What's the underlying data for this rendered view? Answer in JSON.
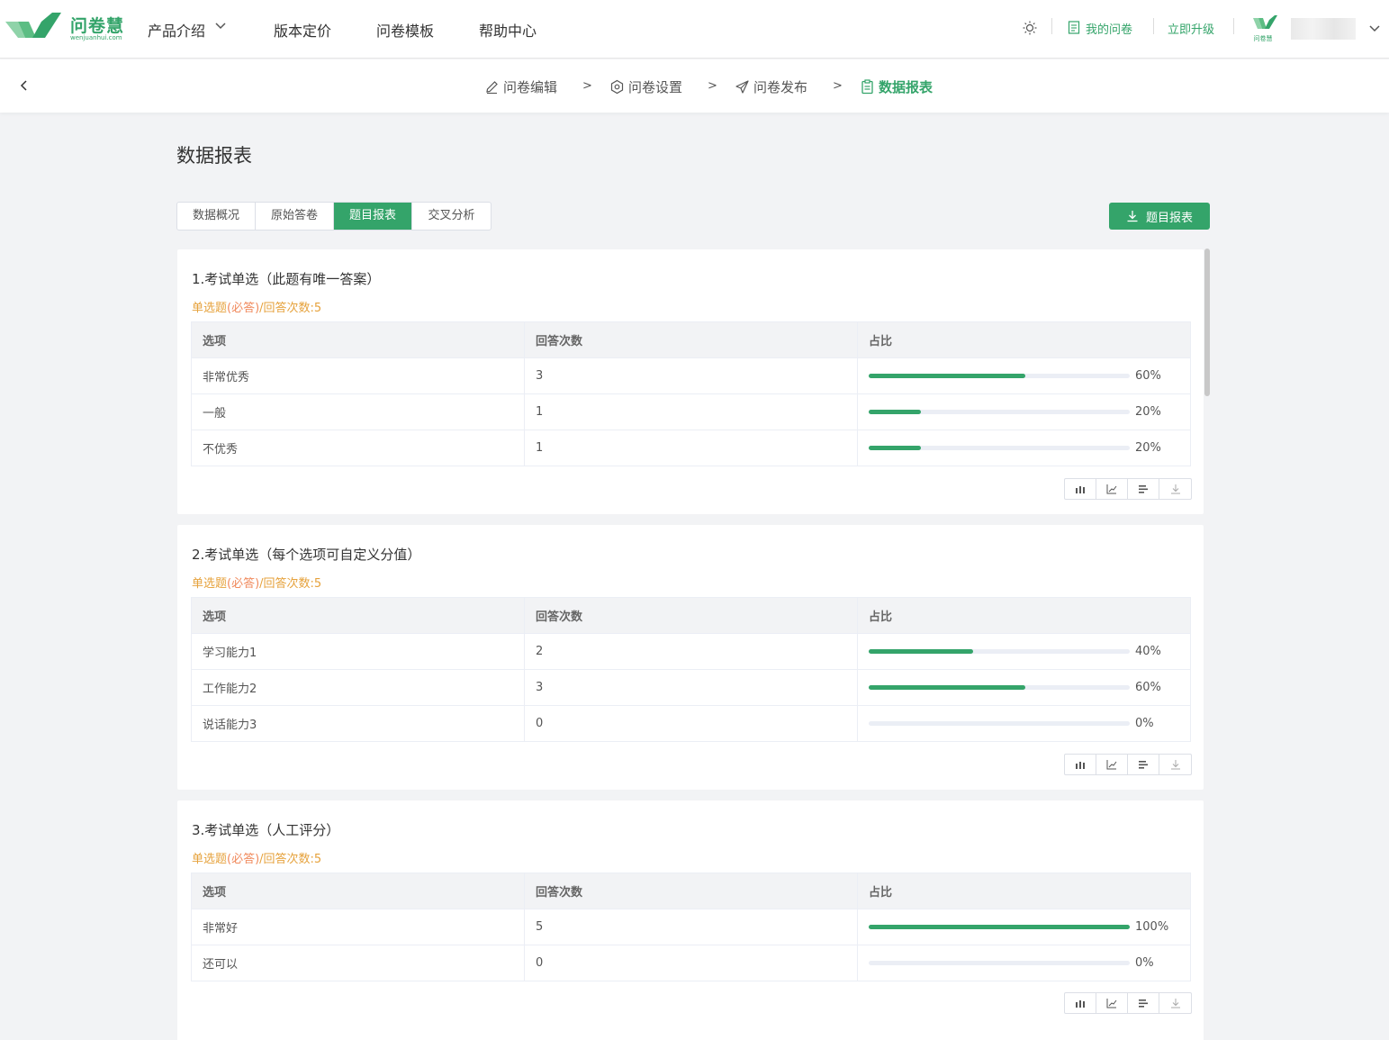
{
  "brand": {
    "name_cn": "问卷慧",
    "name_en": "wenjuanhui.com",
    "color": "#34a46a"
  },
  "nav": {
    "items": [
      "产品介绍",
      "版本定价",
      "问卷模板",
      "帮助中心"
    ],
    "my_surveys": "我的问卷",
    "upgrade": "立即升级",
    "avatar_text": "问卷慧"
  },
  "steps": {
    "edit": "问卷编辑",
    "settings": "问卷设置",
    "publish": "问卷发布",
    "report": "数据报表",
    "separator": ">"
  },
  "page_title": "数据报表",
  "tabs": [
    "数据概况",
    "原始答卷",
    "题目报表",
    "交叉分析"
  ],
  "active_tab": "题目报表",
  "export_label": "题目报表",
  "table_headers": {
    "option": "选项",
    "count": "回答次数",
    "ratio": "占比"
  },
  "questions": [
    {
      "title": "1.考试单选（此题有唯一答案）",
      "meta_type": "单选题",
      "meta_required": "(必答)",
      "meta_count": "/回答次数:5",
      "rows": [
        {
          "option": "非常优秀",
          "count": "3",
          "pct": "60%",
          "value": 60
        },
        {
          "option": "一般",
          "count": "1",
          "pct": "20%",
          "value": 20
        },
        {
          "option": "不优秀",
          "count": "1",
          "pct": "20%",
          "value": 20
        }
      ]
    },
    {
      "title": "2.考试单选（每个选项可自定义分值）",
      "meta_type": "单选题",
      "meta_required": "(必答)",
      "meta_count": "/回答次数:5",
      "rows": [
        {
          "option": "学习能力1",
          "count": "2",
          "pct": "40%",
          "value": 40
        },
        {
          "option": "工作能力2",
          "count": "3",
          "pct": "60%",
          "value": 60
        },
        {
          "option": "说话能力3",
          "count": "0",
          "pct": "0%",
          "value": 0
        }
      ]
    },
    {
      "title": "3.考试单选（人工评分）",
      "meta_type": "单选题",
      "meta_required": "(必答)",
      "meta_count": "/回答次数:5",
      "rows": [
        {
          "option": "非常好",
          "count": "5",
          "pct": "100%",
          "value": 100
        },
        {
          "option": "还可以",
          "count": "0",
          "pct": "0%",
          "value": 0
        }
      ]
    }
  ]
}
